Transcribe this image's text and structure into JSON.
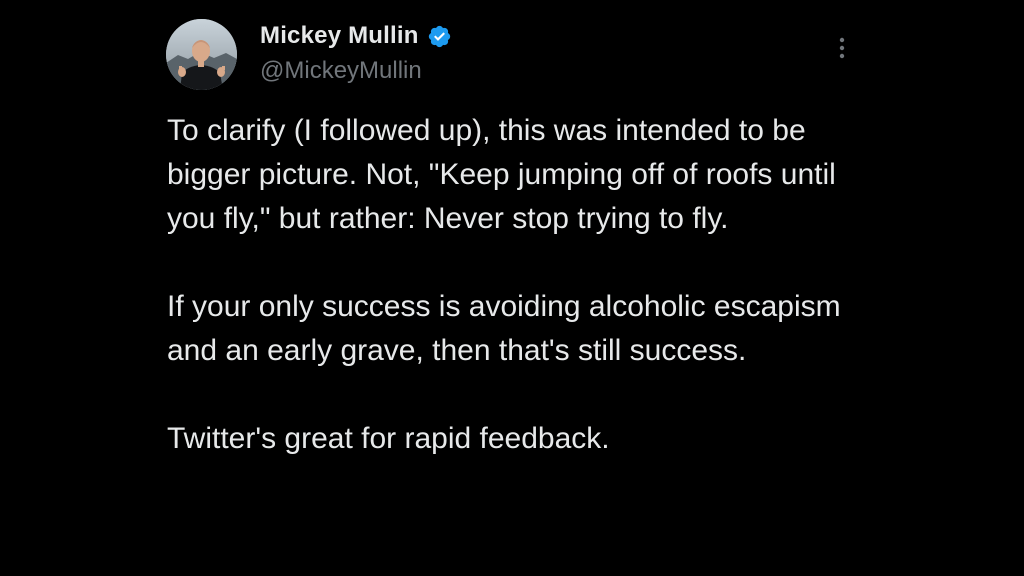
{
  "user": {
    "display_name": "Mickey Mullin",
    "handle": "@MickeyMullin",
    "verified": true,
    "avatar_icon": "profile-photo",
    "verified_icon": "verified-badge-icon",
    "verified_color": "#1d9bf0"
  },
  "tweet": {
    "paragraphs": [
      "To clarify (I followed up), this was intended to be bigger picture. Not, \"Keep jumping off of roofs until you fly,\" but rather: Never stop trying to fly.",
      "If your only success is avoiding alcoholic escapism and an early grave, then that's still success.",
      "Twitter's great for rapid feedback."
    ]
  },
  "menu": {
    "icon": "more-options-icon"
  },
  "colors": {
    "background": "#000000",
    "text_primary": "#e7e9ea",
    "text_secondary": "#71767b"
  }
}
